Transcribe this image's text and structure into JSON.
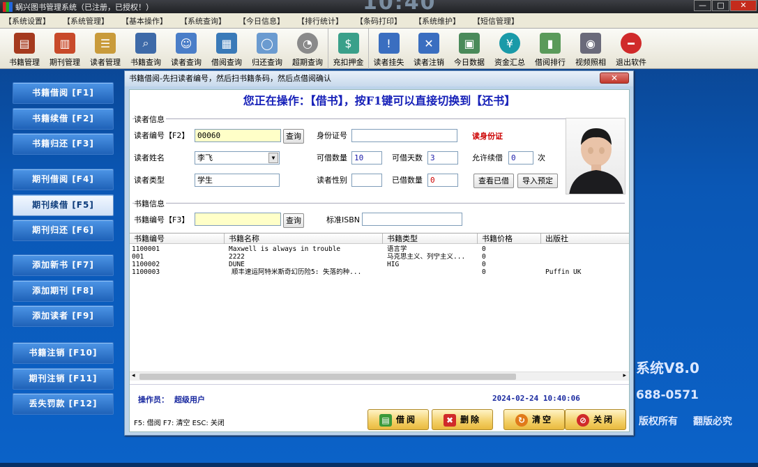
{
  "window": {
    "title": "蜗兴图书管理系统（已注册，已授权！）",
    "clock": "10:40"
  },
  "menu": [
    "【系统设置】",
    "【系统管理】",
    "【基本操作】",
    "【系统查询】",
    "【今日信息】",
    "【排行统计】",
    "【条码打印】",
    "【系统维护】",
    "【短信管理】"
  ],
  "toolbar": [
    {
      "label": "书籍管理",
      "icon": "books-icon",
      "color": "#a53a1e"
    },
    {
      "label": "期刊管理",
      "icon": "magazine-icon",
      "color": "#c84a2a"
    },
    {
      "label": "读者管理",
      "icon": "reader-card-icon",
      "color": "#c99b3b"
    },
    {
      "label": "书籍查询",
      "icon": "book-search-icon",
      "color": "#3e6aa8"
    },
    {
      "label": "读者查询",
      "icon": "user-search-icon",
      "color": "#4a7ec8"
    },
    {
      "label": "借阅查询",
      "icon": "borrow-search-icon",
      "color": "#3a7ab8"
    },
    {
      "label": "归还查询",
      "icon": "magnifier-icon",
      "color": "#6b9bd0"
    },
    {
      "label": "超期查询",
      "icon": "clock-icon",
      "color": "#8a8a8a"
    },
    {
      "label": "充扣押金",
      "icon": "deposit-icon",
      "color": "#3aa08a"
    },
    {
      "label": "读者挂失",
      "icon": "user-warning-icon",
      "color": "#3a6ec0"
    },
    {
      "label": "读者注销",
      "icon": "user-cancel-icon",
      "color": "#3a6ec0"
    },
    {
      "label": "今日数据",
      "icon": "data-icon",
      "color": "#4a8a5a"
    },
    {
      "label": "资金汇总",
      "icon": "yen-icon",
      "color": "#1a9aa8"
    },
    {
      "label": "借阅排行",
      "icon": "chart-icon",
      "color": "#5a9a5a"
    },
    {
      "label": "视频照相",
      "icon": "camera-icon",
      "color": "#6a6a7a"
    },
    {
      "label": "退出软件",
      "icon": "exit-icon",
      "color": "#d02a2a"
    }
  ],
  "sidebar": [
    {
      "label": "书籍借阅 [F1]",
      "active": false
    },
    {
      "label": "书籍续借 [F2]",
      "active": false
    },
    {
      "label": "书籍归还 [F3]",
      "active": false
    },
    {
      "label": "期刊借阅 [F4]",
      "active": false
    },
    {
      "label": "期刊续借 [F5]",
      "active": true
    },
    {
      "label": "期刊归还 [F6]",
      "active": false
    },
    {
      "label": "添加新书 [F7]",
      "active": false
    },
    {
      "label": "添加期刊 [F8]",
      "active": false
    },
    {
      "label": "添加读者 [F9]",
      "active": false
    },
    {
      "label": "书籍注销 [F10]",
      "active": false
    },
    {
      "label": "期刊注销 [F11]",
      "active": false
    },
    {
      "label": "丢失罚款 [F12]",
      "active": false
    }
  ],
  "background": {
    "system": "系统V8.0",
    "phone": "688-0571",
    "copyright1": "版权所有",
    "copyright2": "翻版必究"
  },
  "dialog": {
    "title": "书籍借阅-先扫读者编号，然后扫书籍条码，然后点借阅确认",
    "close": "✕",
    "banner": "您正在操作：【借书】，按F1键可以直接切换到【还书】",
    "reader_group": "读者信息",
    "reader_no_label": "读者编号【F2】",
    "reader_no": "00060",
    "query1": "查询",
    "id_label": "身份证号",
    "id_value": "",
    "read_id": "读身份证",
    "name_label": "读者姓名",
    "name_value": "李飞",
    "can_borrow_label": "可借数量",
    "can_borrow": "10",
    "days_label": "可借天数",
    "days": "3",
    "renew_label": "允许续借",
    "renew": "0",
    "renew_unit": "次",
    "type_label": "读者类型",
    "type_value": "学生",
    "gender_label": "读者性别",
    "gender_value": "",
    "borrowed_label": "已借数量",
    "borrowed": "0",
    "view_borrowed": "查看已借",
    "import_reserve": "导入预定",
    "book_group": "书籍信息",
    "book_no_label": "书籍编号【F3】",
    "book_no": "",
    "query2": "查询",
    "isbn_label": "标准ISBN",
    "isbn": "",
    "columns": [
      "书籍编号",
      "书籍名称",
      "书籍类型",
      "书籍价格",
      "出版社"
    ],
    "rows": [
      {
        "no": "1100001",
        "name": "Maxwell is always in trouble",
        "type": "语言学",
        "price": "0",
        "pub": ""
      },
      {
        "no": "001",
        "name": "2222",
        "type": "马克思主义、列宁主义...",
        "price": "0",
        "pub": ""
      },
      {
        "no": "1100002",
        "name": "DUNE",
        "type": "HIG",
        "price": "0",
        "pub": ""
      },
      {
        "no": "1100003",
        "name": "顺丰速运阿特米斯奇幻历险5: 失落的种...",
        "type": "",
        "price": "0",
        "pub": "Puffin UK"
      }
    ],
    "operator_label": "操作员：",
    "operator": "超级用户",
    "datetime": "2024-02-24 10:40:06",
    "hint": "F5: 借阅 F7: 清空 ESC: 关闭",
    "btn_borrow": "借阅",
    "btn_delete": "删除",
    "btn_clear": "清空",
    "btn_close": "关闭"
  }
}
